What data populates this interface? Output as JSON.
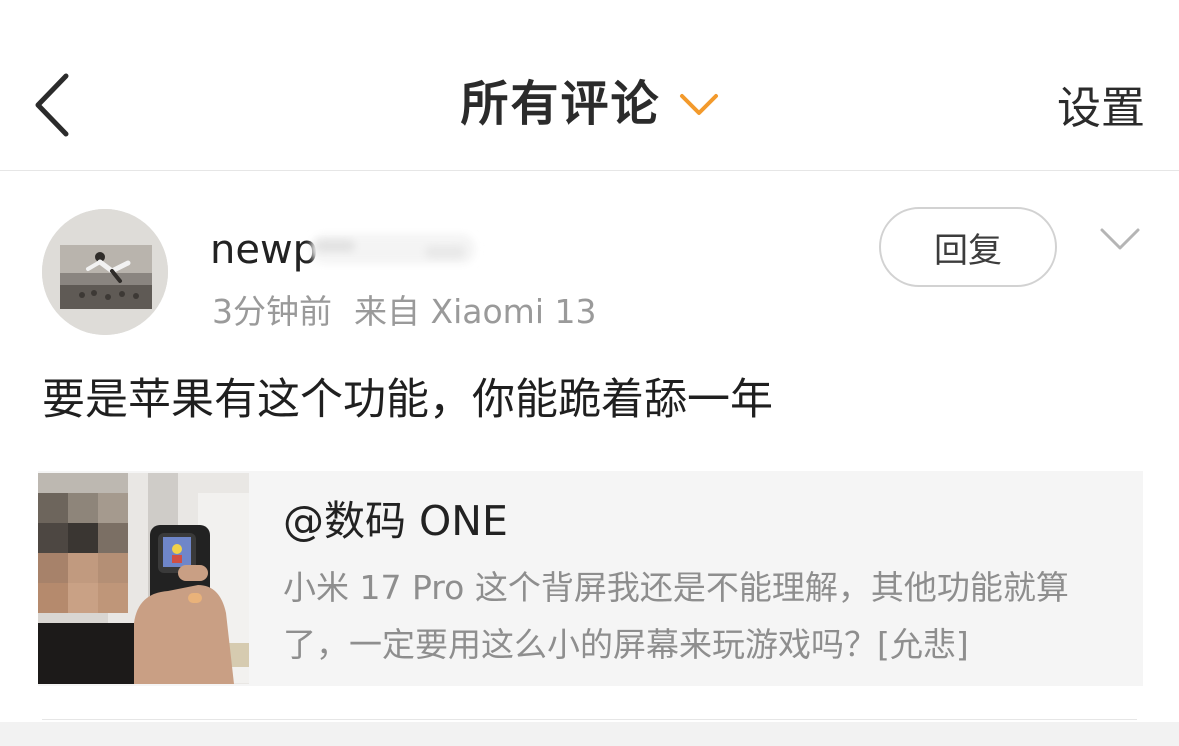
{
  "header": {
    "title": "所有评论",
    "settings_label": "设置",
    "accent_color": "#f39a2c",
    "back_icon": "chevron-left-icon",
    "title_dropdown_icon": "chevron-down-icon"
  },
  "comment": {
    "username": "newp",
    "username_obscured": true,
    "time": "3分钟前",
    "source": "来自 Xiaomi 13",
    "reply_label": "回复",
    "more_icon": "chevron-down-icon",
    "text": "要是苹果有这个功能，你能跪着舔一年"
  },
  "quote": {
    "author": "@数码 ONE",
    "text_line1": "小米 17 Pro 这个背屏我还是不能理解，其他功能就算",
    "text_line2": "了，一定要用这么小的屏幕来玩游戏吗？[允悲]",
    "thumbnail": "person-holding-phone-thumbnail"
  }
}
